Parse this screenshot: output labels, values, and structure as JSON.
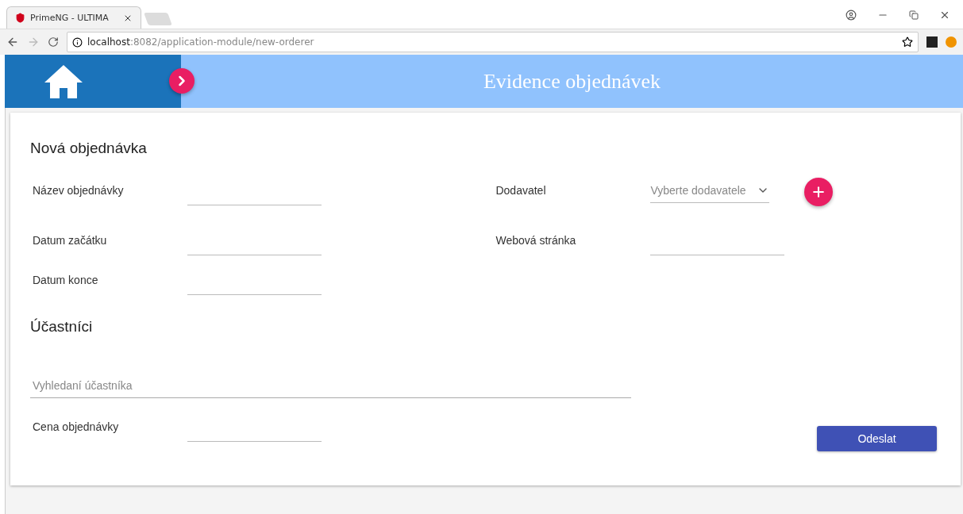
{
  "browser": {
    "tab_title": "PrimeNG - ULTIMA",
    "url_host": "localhost",
    "url_rest": ":8082/application-module/new-orderer"
  },
  "header": {
    "title": "Evidence objednávek"
  },
  "form": {
    "title": "Nová objednávka",
    "left_fields": [
      {
        "label": "Název objednávky",
        "kind": "text"
      },
      {
        "label": "Datum začátku",
        "kind": "text"
      },
      {
        "label": "Datum konce",
        "kind": "text"
      }
    ],
    "right_fields": [
      {
        "label": "Dodavatel",
        "kind": "select",
        "placeholder": "Vyberte dodavatele"
      },
      {
        "label": "Webová stránka",
        "kind": "text"
      }
    ],
    "participants_title": "Účastníci",
    "search": {
      "placeholder": "Vyhledaní účastníka"
    },
    "price": {
      "label": "Cena objednávky",
      "kind": "text"
    },
    "submit": "Odeslat"
  }
}
